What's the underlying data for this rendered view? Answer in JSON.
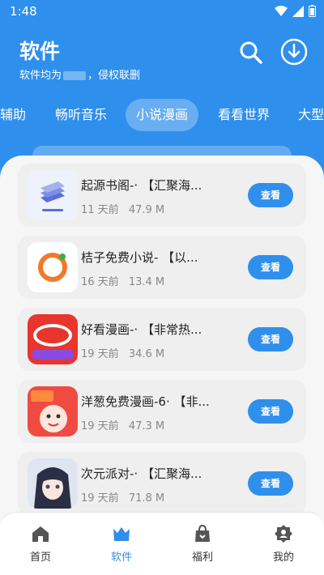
{
  "status": {
    "time": "1:48"
  },
  "header": {
    "title": "软件",
    "subtitle_prefix": "软件均为",
    "subtitle_suffix": "，侵权联删"
  },
  "tabs": [
    {
      "label": "辅助"
    },
    {
      "label": "畅听音乐"
    },
    {
      "label": "小说漫画",
      "active": true
    },
    {
      "label": "看看世界"
    },
    {
      "label": "大型"
    }
  ],
  "apps": [
    {
      "name": "起源书阁-·          【汇聚海...",
      "time": "11 天前",
      "size": "47.9 M",
      "button": "查看",
      "icon": "books-icon"
    },
    {
      "name": "桔子免费小说-          【以...",
      "time": "16 天前",
      "size": "13.4 M",
      "button": "查看",
      "icon": "orange-ring-icon"
    },
    {
      "name": "好看漫画-·        【非常热...",
      "time": "19 天前",
      "size": "34.6 M",
      "button": "查看",
      "icon": "comic-free-icon"
    },
    {
      "name": "洋葱免费漫画-6·   【非...",
      "time": "19 天前",
      "size": "47.3 M",
      "button": "查看",
      "icon": "onion-icon"
    },
    {
      "name": "次元派对-·          【汇聚海...",
      "time": "19 天前",
      "size": "71.8 M",
      "button": "查看",
      "icon": "anime-girl-icon"
    }
  ],
  "nav": [
    {
      "label": "首页",
      "icon": "home-icon"
    },
    {
      "label": "软件",
      "icon": "crown-icon",
      "active": true
    },
    {
      "label": "福利",
      "icon": "bag-icon"
    },
    {
      "label": "我的",
      "icon": "profile-icon"
    }
  ],
  "colors": {
    "primary": "#2f8fec",
    "background": "#f6f6f6",
    "card": "#efefef"
  }
}
